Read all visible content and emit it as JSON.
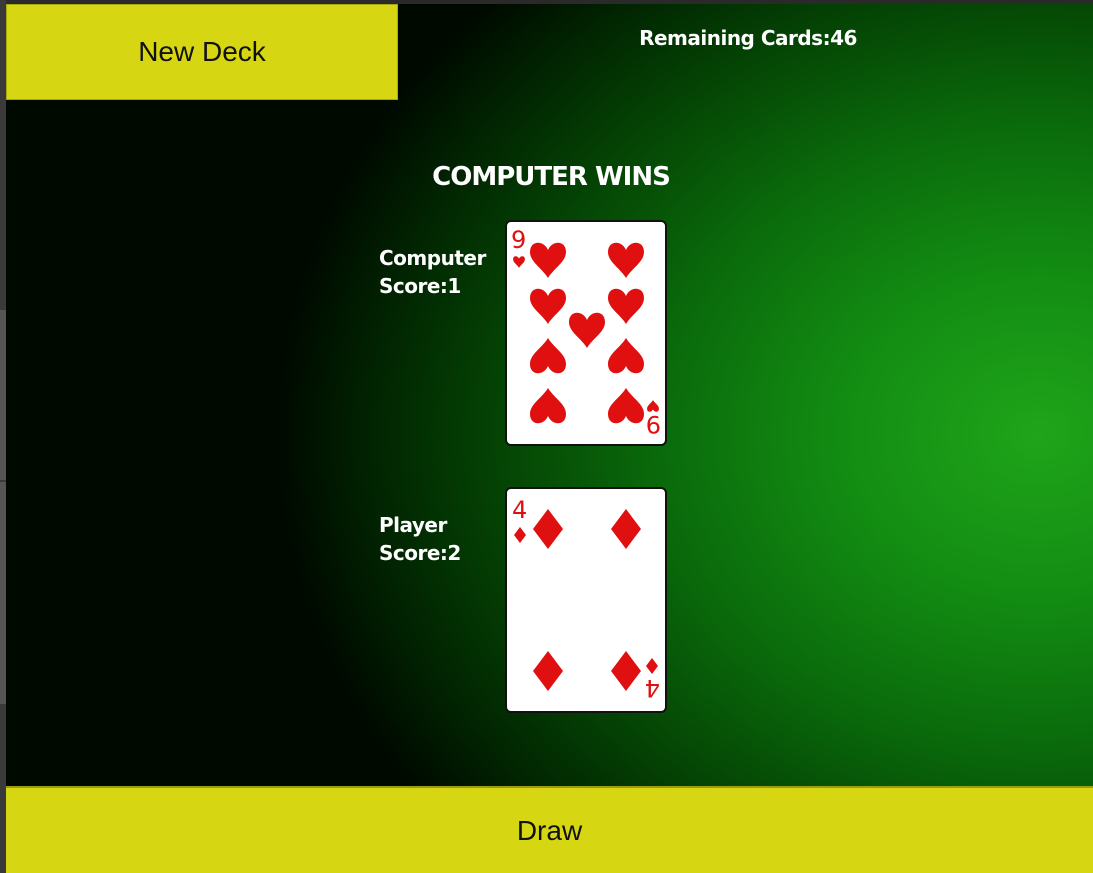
{
  "header": {
    "new_deck_label": "New Deck",
    "remaining_text": "Remaining Cards:46"
  },
  "game": {
    "result_text": "COMPUTER WINS",
    "computer": {
      "label_line1": "Computer",
      "label_line2": "Score:1",
      "card": {
        "rank": "9",
        "suit": "hearts",
        "suit_icon": "heart-icon",
        "color": "#e01010"
      }
    },
    "player": {
      "label_line1": "Player",
      "label_line2": "Score:2",
      "card": {
        "rank": "4",
        "suit": "diamonds",
        "suit_icon": "diamond-icon",
        "color": "#e01010"
      }
    }
  },
  "footer": {
    "draw_label": "Draw"
  },
  "colors": {
    "button_yellow": "#d7d613",
    "felt_green": "#128a12",
    "suit_red": "#e01010"
  }
}
